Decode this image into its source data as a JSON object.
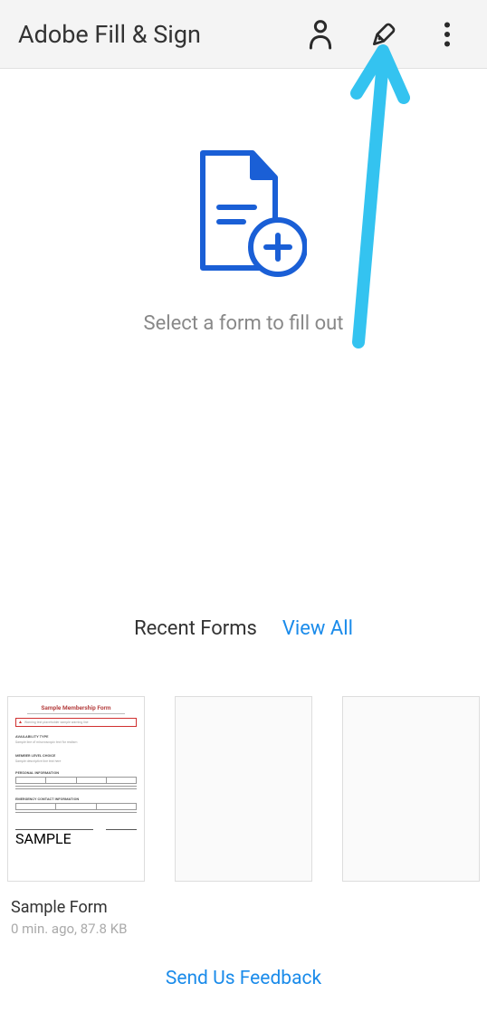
{
  "header": {
    "title": "Adobe Fill & Sign"
  },
  "main": {
    "prompt": "Select a form to fill out"
  },
  "recent": {
    "title": "Recent Forms",
    "viewAll": "View All"
  },
  "cards": [
    {
      "label": "Sample Form",
      "meta": "0 min. ago, 87.8 KB",
      "docTitle": "Sample Membership Form",
      "watermark": "SAMPLE"
    }
  ],
  "feedback": "Send Us Feedback",
  "colors": {
    "link": "#1a8bea",
    "arrow": "#34c3f0",
    "iconBlue": "#1a5fd6"
  }
}
